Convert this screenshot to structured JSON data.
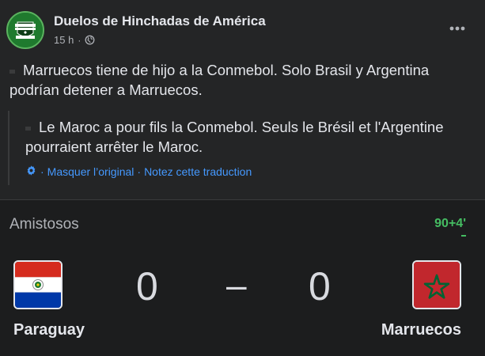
{
  "post": {
    "page_name": "Duelos de Hinchadas de América",
    "time": "15 h",
    "separator": "·",
    "text_original": "Marruecos tiene de hijo a la Conmebol. Solo Brasil y Argentina podrían detener a Marruecos.",
    "text_translated": "Le Maroc a pour fils la Conmebol. Seuls le Brésil et l'Argentine pourraient arrêter le Maroc.",
    "hide_original_label": "Masquer l’original",
    "rate_translation_label": "Notez cette traduction",
    "links_separator": "·",
    "icons": [
      "avatar-logo",
      "globe-icon",
      "more-options-icon",
      "translate-gear-icon"
    ]
  },
  "match": {
    "competition": "Amistosos",
    "minute": "90+4'",
    "home": {
      "team": "Paraguay",
      "score": "0",
      "flag": "paraguay-flag"
    },
    "away": {
      "team": "Marruecos",
      "score": "0",
      "flag": "morocco-flag"
    },
    "score_separator": "–",
    "colors": {
      "live": "#45bd62",
      "link": "#4599ff",
      "background": "#242526"
    }
  }
}
